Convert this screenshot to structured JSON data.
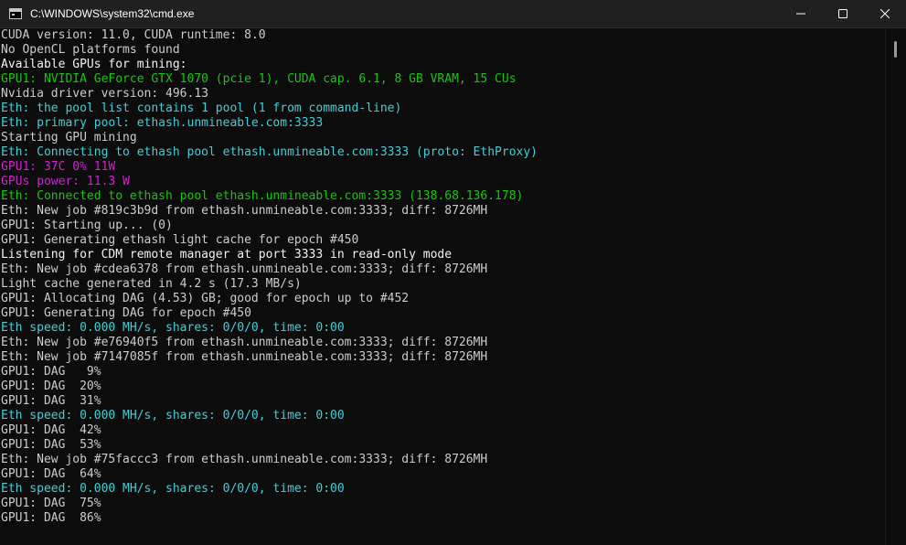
{
  "window": {
    "title": "C:\\WINDOWS\\system32\\cmd.exe",
    "icon": "cmd-icon",
    "controls": [
      "minimize-icon",
      "maximize-icon",
      "close-icon"
    ]
  },
  "colors": {
    "white": "#cccccc",
    "bright": "#f2f2f2",
    "green": "#16c60c",
    "cyan": "#3ed0d6",
    "magenta": "#d61cd6"
  },
  "lines": [
    {
      "text": "CUDA version: 11.0, CUDA runtime: 8.0",
      "color": "white"
    },
    {
      "text": "No OpenCL platforms found",
      "color": "white"
    },
    {
      "text": "Available GPUs for mining:",
      "color": "bright"
    },
    {
      "text": "GPU1: NVIDIA GeForce GTX 1070 (pcie 1), CUDA cap. 6.1, 8 GB VRAM, 15 CUs",
      "color": "green"
    },
    {
      "text": "Nvidia driver version: 496.13",
      "color": "white"
    },
    {
      "text": "Eth: the pool list contains 1 pool (1 from command-line)",
      "color": "cyan"
    },
    {
      "text": "Eth: primary pool: ethash.unmineable.com:3333",
      "color": "cyan"
    },
    {
      "text": "Starting GPU mining",
      "color": "white"
    },
    {
      "text": "Eth: Connecting to ethash pool ethash.unmineable.com:3333 (proto: EthProxy)",
      "color": "cyan"
    },
    {
      "text": "GPU1: 37C 0% 11W",
      "color": "magenta"
    },
    {
      "text": "GPUs power: 11.3 W",
      "color": "magenta"
    },
    {
      "text": "Eth: Connected to ethash pool ethash.unmineable.com:3333 (138.68.136.178)",
      "color": "green"
    },
    {
      "text": "Eth: New job #819c3b9d from ethash.unmineable.com:3333; diff: 8726MH",
      "color": "white"
    },
    {
      "text": "GPU1: Starting up... (0)",
      "color": "white"
    },
    {
      "text": "GPU1: Generating ethash light cache for epoch #450",
      "color": "white"
    },
    {
      "text": "Listening for CDM remote manager at port 3333 in read-only mode",
      "color": "bright"
    },
    {
      "text": "Eth: New job #cdea6378 from ethash.unmineable.com:3333; diff: 8726MH",
      "color": "white"
    },
    {
      "text": "Light cache generated in 4.2 s (17.3 MB/s)",
      "color": "white"
    },
    {
      "text": "GPU1: Allocating DAG (4.53) GB; good for epoch up to #452",
      "color": "white"
    },
    {
      "text": "GPU1: Generating DAG for epoch #450",
      "color": "white"
    },
    {
      "text": "Eth speed: 0.000 MH/s, shares: 0/0/0, time: 0:00",
      "color": "cyan"
    },
    {
      "text": "Eth: New job #e76940f5 from ethash.unmineable.com:3333; diff: 8726MH",
      "color": "white"
    },
    {
      "text": "Eth: New job #7147085f from ethash.unmineable.com:3333; diff: 8726MH",
      "color": "white"
    },
    {
      "text": "GPU1: DAG   9%",
      "color": "white"
    },
    {
      "text": "GPU1: DAG  20%",
      "color": "white"
    },
    {
      "text": "GPU1: DAG  31%",
      "color": "white"
    },
    {
      "text": "Eth speed: 0.000 MH/s, shares: 0/0/0, time: 0:00",
      "color": "cyan"
    },
    {
      "text": "GPU1: DAG  42%",
      "color": "white"
    },
    {
      "text": "GPU1: DAG  53%",
      "color": "white"
    },
    {
      "text": "Eth: New job #75faccc3 from ethash.unmineable.com:3333; diff: 8726MH",
      "color": "white"
    },
    {
      "text": "GPU1: DAG  64%",
      "color": "white"
    },
    {
      "text": "Eth speed: 0.000 MH/s, shares: 0/0/0, time: 0:00",
      "color": "cyan"
    },
    {
      "text": "GPU1: DAG  75%",
      "color": "white"
    },
    {
      "text": "GPU1: DAG  86%",
      "color": "white"
    }
  ]
}
